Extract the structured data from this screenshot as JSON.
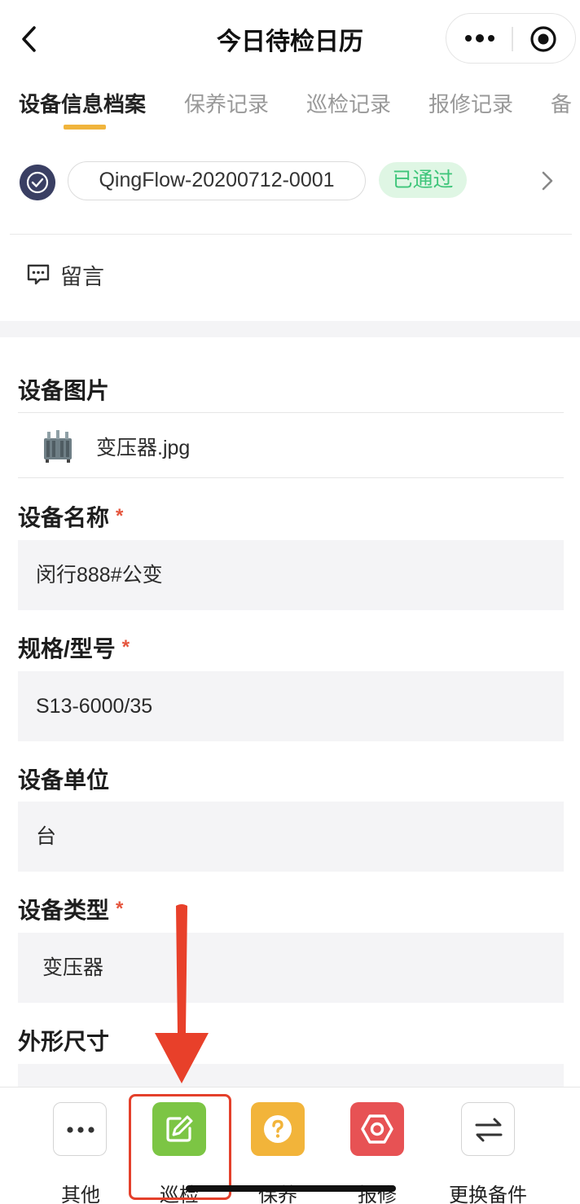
{
  "nav": {
    "title": "今日待检日历"
  },
  "tabs": [
    {
      "label": "设备信息档案"
    },
    {
      "label": "保养记录"
    },
    {
      "label": "巡检记录"
    },
    {
      "label": "报修记录"
    },
    {
      "label": "备"
    }
  ],
  "record": {
    "id": "QingFlow-20200712-0001",
    "status": "已通过"
  },
  "comment": {
    "label": "留言"
  },
  "form": {
    "image": {
      "label": "设备图片",
      "file": "变压器.jpg"
    },
    "name": {
      "label": "设备名称",
      "required": "*",
      "value": "闵行888#公变"
    },
    "model": {
      "label": "规格/型号",
      "required": "*",
      "value": "S13-6000/35"
    },
    "unit": {
      "label": "设备单位",
      "value": "台"
    },
    "type": {
      "label": "设备类型",
      "required": "*",
      "value": "变压器"
    },
    "size": {
      "label": "外形尺寸",
      "value": ""
    }
  },
  "actions": [
    {
      "label": "其他",
      "icon": "more-icon",
      "color": "#ffffff"
    },
    {
      "label": "巡检",
      "icon": "edit-icon",
      "color": "#7cc544"
    },
    {
      "label": "保养",
      "icon": "question-icon",
      "color": "#f2b43a"
    },
    {
      "label": "报修",
      "icon": "repair-icon",
      "color": "#e75254"
    },
    {
      "label": "更换备件",
      "icon": "swap-icon",
      "color": "#ffffff"
    }
  ],
  "colors": {
    "accent": "#f0b43c",
    "status_green": "#3ec57a",
    "annotation_red": "#e4402b"
  }
}
